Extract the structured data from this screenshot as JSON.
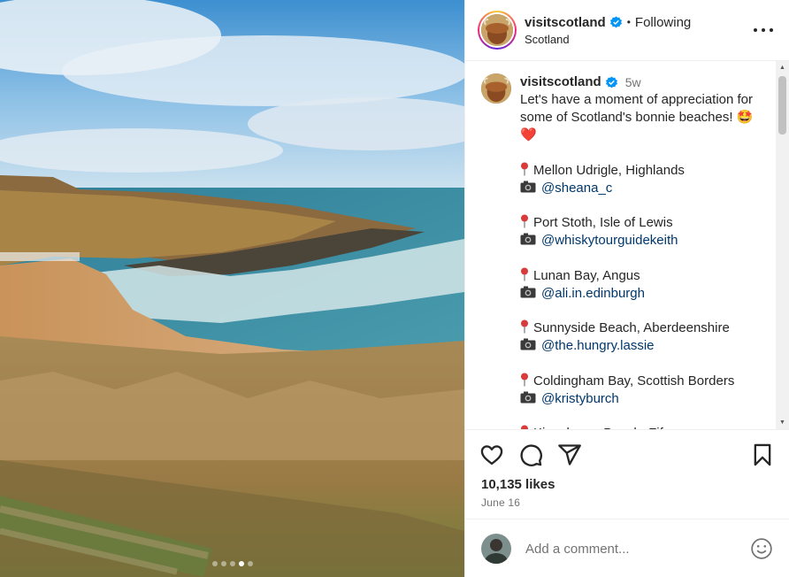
{
  "header": {
    "username": "visitscotland",
    "separator": "•",
    "follow_status": "Following",
    "location": "Scotland"
  },
  "caption": {
    "username": "visitscotland",
    "time": "5w",
    "intro": "Let's have a moment of appreciation for some of Scotland's bonnie beaches! 🤩\n❤️",
    "entries": [
      {
        "location": "Mellon Udrigle, Highlands",
        "handle": "@sheana_c"
      },
      {
        "location": "Port Stoth, Isle of Lewis",
        "handle": "@whiskytourguidekeith"
      },
      {
        "location": "Lunan Bay, Angus",
        "handle": "@ali.in.edinburgh"
      },
      {
        "location": "Sunnyside Beach, Aberdeenshire",
        "handle": "@the.hungry.lassie"
      },
      {
        "location": "Coldingham Bay, Scottish Borders",
        "handle": "@kristyburch"
      },
      {
        "location": "Kingsbarns Beach, Fife",
        "handle": ""
      }
    ]
  },
  "engagement": {
    "likes": "10,135 likes",
    "date": "June 16"
  },
  "comment": {
    "placeholder": "Add a comment..."
  },
  "carousel": {
    "count": 5,
    "active_index": 3
  },
  "icons": {
    "verified": "verified-badge-icon",
    "more": "more-options-icon",
    "like": "heart-icon",
    "comment": "comment-icon",
    "share": "share-icon",
    "save": "bookmark-icon",
    "emoji": "emoji-icon",
    "pin": "round-pushpin-icon",
    "camera": "camera-icon"
  },
  "colors": {
    "verified": "#0095f6",
    "link": "#00376b",
    "secondary_text": "#737373"
  }
}
